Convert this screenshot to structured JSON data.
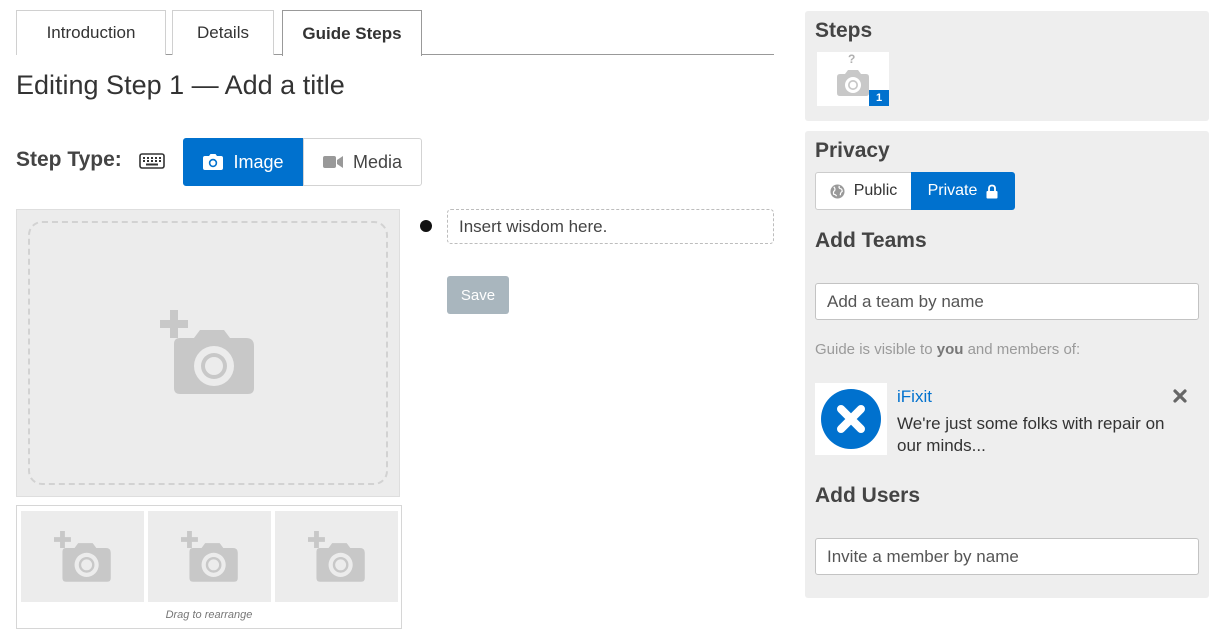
{
  "tabs": [
    {
      "label": "Introduction",
      "active": false
    },
    {
      "label": "Details",
      "active": false
    },
    {
      "label": "Guide Steps",
      "active": true
    }
  ],
  "editor": {
    "title": "Editing Step 1 — Add a title",
    "step_type_label": "Step Type:",
    "step_types": [
      {
        "label": "Image",
        "icon": "camera-icon",
        "selected": true
      },
      {
        "label": "Media",
        "icon": "video-icon",
        "selected": false
      }
    ],
    "bullet_placeholder": "Insert wisdom here.",
    "save_label": "Save",
    "drag_hint": "Drag to rearrange"
  },
  "sidebar": {
    "steps_heading": "Steps",
    "step_number": "1",
    "step_placeholder_mark": "?",
    "privacy_heading": "Privacy",
    "privacy_options": [
      {
        "label": "Public",
        "icon": "globe-icon",
        "selected": false
      },
      {
        "label": "Private",
        "icon": "lock-icon",
        "selected": true
      }
    ],
    "add_teams_heading": "Add Teams",
    "team_placeholder": "Add a team by name",
    "visibility_prefix": "Guide is visible to ",
    "visibility_you": "you",
    "visibility_suffix": " and members of:",
    "team": {
      "name": "iFixit",
      "description": "We're just some folks with repair on our minds..."
    },
    "add_users_heading": "Add Users",
    "user_placeholder": "Invite a member by name"
  },
  "colors": {
    "accent": "#0071ce",
    "panel_bg": "#eeeeee",
    "save_disabled": "#a9b6be"
  }
}
